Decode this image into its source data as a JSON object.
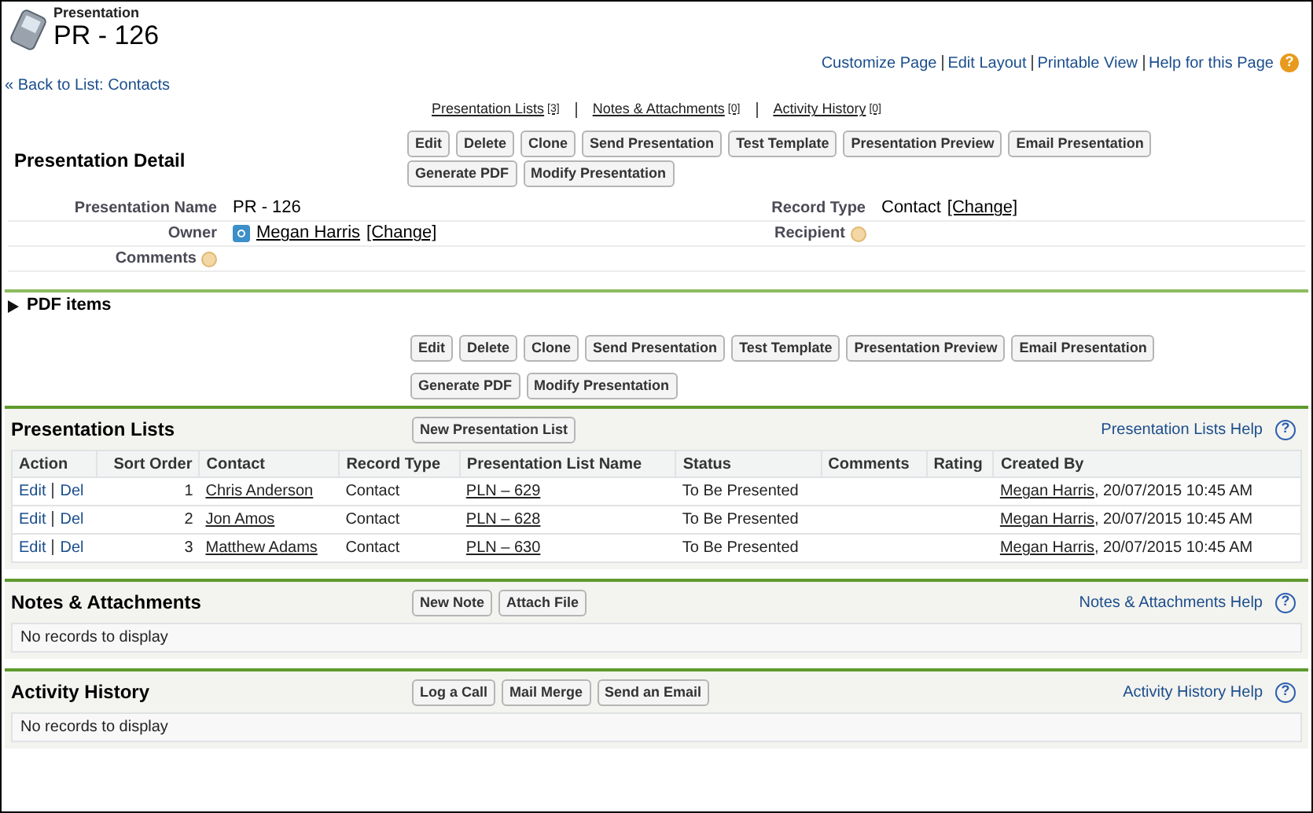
{
  "header": {
    "object_type": "Presentation",
    "title": "PR - 126"
  },
  "top_links": [
    "Customize Page",
    "Edit Layout",
    "Printable View",
    "Help for this Page"
  ],
  "help_icon": "?",
  "back_link": "« Back to List: Contacts",
  "jump_links": [
    {
      "label": "Presentation Lists",
      "count": "[3]"
    },
    {
      "label": "Notes & Attachments",
      "count": "[0]"
    },
    {
      "label": "Activity History",
      "count": "[0]"
    }
  ],
  "detail": {
    "title": "Presentation Detail",
    "buttons": [
      "Edit",
      "Delete",
      "Clone",
      "Send Presentation",
      "Test Template",
      "Presentation Preview",
      "Email Presentation",
      "Generate PDF",
      "Modify Presentation"
    ],
    "rows": [
      {
        "left": {
          "label": "Presentation Name",
          "kind": "text",
          "value": "PR - 126"
        },
        "right": {
          "label": "Record Type",
          "kind": "text",
          "value": "Contact",
          "change": "[Change]"
        }
      },
      {
        "left": {
          "label": "Owner",
          "kind": "user",
          "value": "Megan Harris",
          "change": "[Change]"
        },
        "right": {
          "label": "Recipient",
          "kind": "help"
        }
      },
      {
        "left": {
          "label": "Comments",
          "kind": "help"
        }
      }
    ]
  },
  "pdf_section": {
    "title": "PDF items",
    "expanded": false,
    "buttons": [
      "Edit",
      "Delete",
      "Clone",
      "Send Presentation",
      "Test Template",
      "Presentation Preview",
      "Email Presentation",
      "Generate PDF",
      "Modify Presentation"
    ]
  },
  "related_lists": [
    {
      "title": "Presentation Lists",
      "buttons": [
        "New Presentation List"
      ],
      "help_link": "Presentation Lists Help",
      "help_icon": "?",
      "columns": [
        "Action",
        "Sort Order",
        "Contact",
        "Record Type",
        "Presentation List Name",
        "Status",
        "Comments",
        "Rating",
        "Created By"
      ],
      "rows": [
        {
          "actions": [
            "Edit",
            "Del"
          ],
          "sort_order": "1",
          "contact": "Chris Anderson",
          "record_type": "Contact",
          "list_name": "PLN – 629",
          "status": "To Be Presented",
          "created_by": "Megan Harris",
          "created_date": ", 20/07/2015 10:45 AM"
        },
        {
          "actions": [
            "Edit",
            "Del"
          ],
          "sort_order": "2",
          "contact": "Jon Amos",
          "record_type": "Contact",
          "list_name": "PLN – 628",
          "status": "To Be Presented",
          "created_by": "Megan Harris",
          "created_date": ", 20/07/2015 10:45 AM"
        },
        {
          "actions": [
            "Edit",
            "Del"
          ],
          "sort_order": "3",
          "contact": "Matthew Adams",
          "record_type": "Contact",
          "list_name": "PLN – 630",
          "status": "To Be Presented",
          "created_by": "Megan Harris",
          "created_date": ", 20/07/2015 10:45 AM"
        }
      ]
    },
    {
      "title": "Notes & Attachments",
      "buttons": [
        "New Note",
        "Attach File"
      ],
      "help_link": "Notes & Attachments Help",
      "help_icon": "?",
      "empty_text": "No records to display"
    },
    {
      "title": "Activity History",
      "buttons": [
        "Log a Call",
        "Mail Merge",
        "Send an Email"
      ],
      "help_link": "Activity History Help",
      "help_icon": "?",
      "empty_text": "No records to display"
    }
  ]
}
